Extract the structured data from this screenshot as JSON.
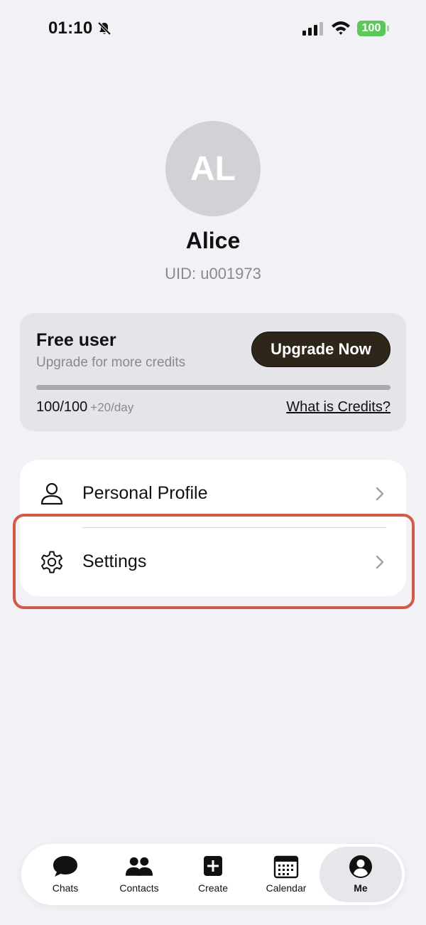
{
  "status_bar": {
    "time": "01:10",
    "battery": "100"
  },
  "profile": {
    "initials": "AL",
    "name": "Alice",
    "uid": "UID: u001973"
  },
  "credits_card": {
    "plan": "Free user",
    "subtitle": "Upgrade for more credits",
    "upgrade_label": "Upgrade Now",
    "credits": "100/100",
    "rate": "+20/day",
    "link": "What is Credits?",
    "progress_fraction": 1.0
  },
  "menu": {
    "items": [
      {
        "label": "Personal Profile",
        "icon": "person-icon"
      },
      {
        "label": "Settings",
        "icon": "gear-icon"
      }
    ]
  },
  "tabs": [
    {
      "label": "Chats",
      "icon": "chat-bubble-icon"
    },
    {
      "label": "Contacts",
      "icon": "contacts-icon"
    },
    {
      "label": "Create",
      "icon": "plus-square-icon"
    },
    {
      "label": "Calendar",
      "icon": "calendar-icon"
    },
    {
      "label": "Me",
      "icon": "user-circle-icon",
      "active": true
    }
  ],
  "colors": {
    "background": "#f1f1f6",
    "upgrade_button": "#2e2618",
    "battery": "#5cc85c",
    "highlight": "#d25a48"
  }
}
